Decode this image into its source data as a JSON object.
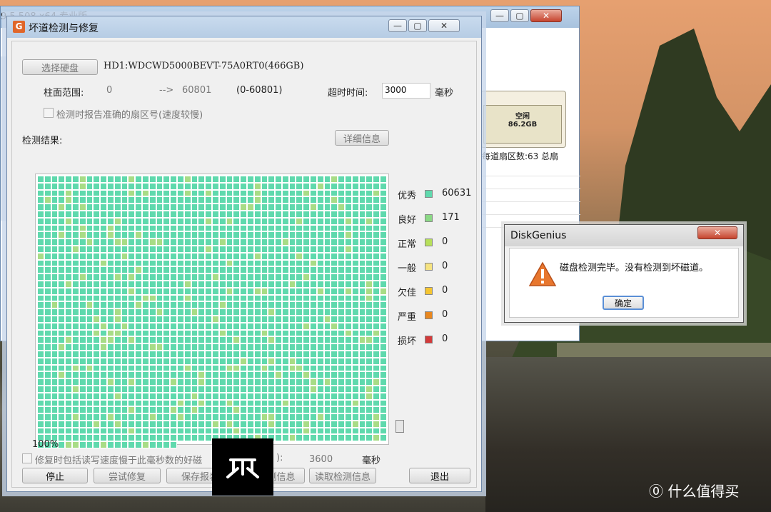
{
  "back_window": {
    "title": "9.5.508 x64 专业版",
    "free_label": "空闲",
    "free_size": "86.2GB",
    "sector_info": "每道扇区数:63  总扇"
  },
  "main_dialog": {
    "title": "坏道检测与修复",
    "select_disk_btn": "选择硬盘",
    "disk_name": "HD1:WDCWD5000BEVT-75A0RT0(466GB)",
    "cylinder_label": "柱面范围:",
    "cyl_from": "0",
    "cyl_arrow": "-->",
    "cyl_to": "60801",
    "cyl_range": "(0-60801)",
    "timeout_label": "超时时间:",
    "timeout_value": "3000",
    "timeout_unit": "毫秒",
    "report_checkbox": "检测时报告准确的扇区号(速度较慢)",
    "result_label": "检测结果:",
    "detail_btn": "详细信息",
    "progress": "100%",
    "repair_checkbox": "修复时包括读写速度慢于此毫秒数的好磁",
    "repair_suffix": "):",
    "repair_ms": "3600",
    "repair_unit": "毫秒",
    "buttons": {
      "stop": "停止",
      "try_repair": "尝试修复",
      "save_report": "保存报表",
      "load_info": "入检测信息",
      "read_info": "读取检测信息",
      "exit": "退出"
    },
    "legend": [
      {
        "label": "优秀",
        "value": "60631",
        "color": "#5fd9ad"
      },
      {
        "label": "良好",
        "value": "171",
        "color": "#8bd985"
      },
      {
        "label": "正常",
        "value": "0",
        "color": "#b7e05a"
      },
      {
        "label": "一般",
        "value": "0",
        "color": "#f6e380"
      },
      {
        "label": "欠佳",
        "value": "0",
        "color": "#f5c531"
      },
      {
        "label": "严重",
        "value": "0",
        "color": "#e8871f"
      },
      {
        "label": "损坏",
        "value": "0",
        "color": "#d33a3a"
      }
    ]
  },
  "message_box": {
    "title": "DiskGenius",
    "message": "磁盘检测完毕。没有检测到坏磁道。",
    "ok_btn": "确定"
  },
  "watermark": {
    "text": "什么值得买"
  }
}
